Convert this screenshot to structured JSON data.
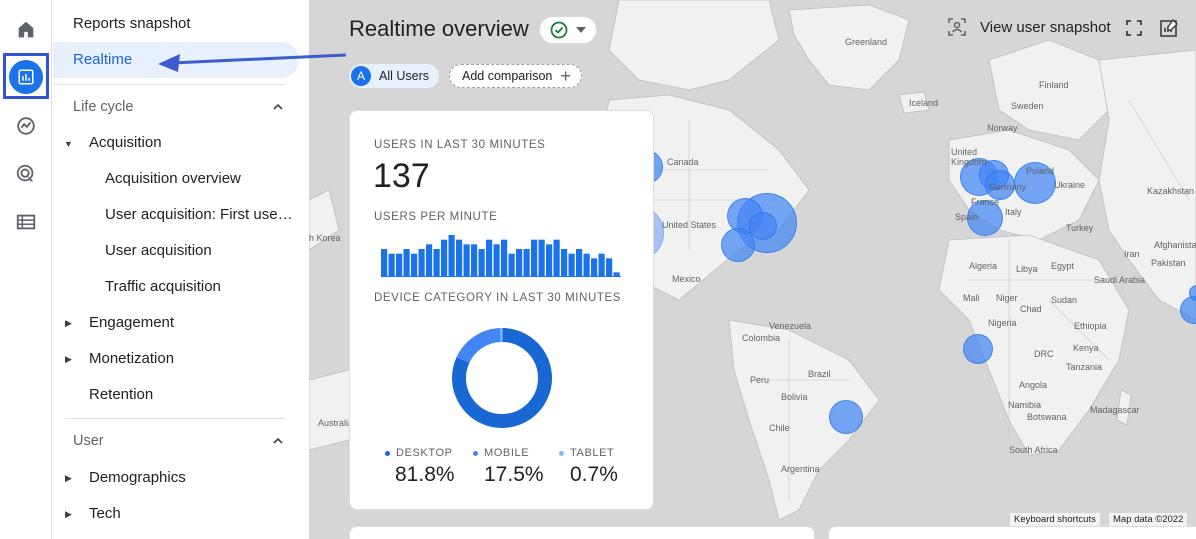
{
  "rail": {
    "items": [
      "home-icon",
      "reports-icon",
      "explore-icon",
      "advertising-icon",
      "configure-icon"
    ]
  },
  "nav": {
    "reports_snapshot": "Reports snapshot",
    "realtime": "Realtime",
    "life_cycle": {
      "title": "Life cycle",
      "acquisition": "Acquisition",
      "acquisition_items": [
        "Acquisition overview",
        "User acquisition: First user ...",
        "User acquisition",
        "Traffic acquisition"
      ],
      "engagement": "Engagement",
      "monetization": "Monetization",
      "retention": "Retention"
    },
    "user": {
      "title": "User",
      "demographics": "Demographics",
      "tech": "Tech"
    }
  },
  "header": {
    "title": "Realtime overview",
    "all_users": "All Users",
    "all_users_avatar": "A",
    "add_comparison": "Add comparison",
    "view_user_snapshot": "View user snapshot"
  },
  "card": {
    "users_label": "USERS IN LAST 30 MINUTES",
    "users_value": "137",
    "per_minute_label": "USERS PER MINUTE",
    "per_minute_values": [
      6,
      5,
      5,
      6,
      5,
      6,
      7,
      6,
      8,
      9,
      8,
      7,
      7,
      6,
      8,
      7,
      8,
      5,
      6,
      6,
      8,
      8,
      7,
      8,
      6,
      5,
      6,
      5,
      4,
      5,
      4,
      1
    ],
    "device_label": "DEVICE CATEGORY IN LAST 30 MINUTES",
    "devices": [
      {
        "name": "DESKTOP",
        "value": "81.8%",
        "share": 81.8,
        "color": "#1967d2"
      },
      {
        "name": "MOBILE",
        "value": "17.5%",
        "share": 17.5,
        "color": "#4285f4"
      },
      {
        "name": "TABLET",
        "value": "0.7%",
        "share": 0.7,
        "color": "#8ab4f8"
      }
    ]
  },
  "map": {
    "labels": [
      "Greenland",
      "Finland",
      "Iceland",
      "Sweden",
      "Norway",
      "Canada",
      "United Kingdom",
      "Poland",
      "Germany",
      "Ukraine",
      "Kazakhstan",
      "France",
      "Italy",
      "Spain",
      "Turkey",
      "United States",
      "Afghanistan",
      "Iran",
      "Pakistan",
      "Mexico",
      "Algeria",
      "Libya",
      "Egypt",
      "Saudi Arabia",
      "Mali",
      "Niger",
      "Chad",
      "Sudan",
      "Venezuela",
      "Colombia",
      "Nigeria",
      "Ethiopia",
      "DRC",
      "Kenya",
      "Peru",
      "Brazil",
      "Tanzania",
      "Bolivia",
      "Angola",
      "Namibia",
      "Madagascar",
      "Botswana",
      "Chile",
      "South Africa",
      "Argentina",
      "Australia",
      "h Korea"
    ],
    "footer_shortcuts": "Keyboard shortcuts",
    "footer_mapdata": "Map data ©2022"
  }
}
